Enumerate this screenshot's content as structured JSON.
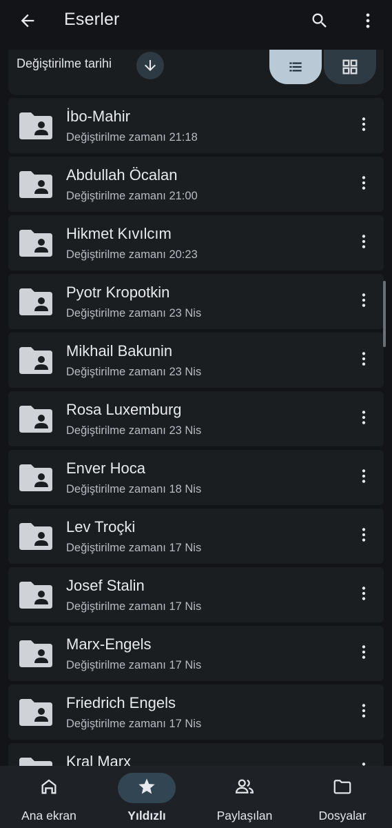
{
  "header": {
    "title": "Eserler",
    "back_icon": "arrow-back-icon",
    "search_icon": "search-icon",
    "more_icon": "more-vert-icon"
  },
  "sort": {
    "label": "Değiştirilme tarihi",
    "direction_icon": "arrow-down-icon"
  },
  "view_toggle": {
    "selected": "list",
    "list_icon": "list-view-icon",
    "grid_icon": "grid-view-icon"
  },
  "folders": [
    {
      "name": "İbo-Mahir",
      "subtitle": "Değiştirilme zamanı 21:18"
    },
    {
      "name": "Abdullah Öcalan",
      "subtitle": "Değiştirilme zamanı 21:00"
    },
    {
      "name": "Hikmet Kıvılcım",
      "subtitle": "Değiştirilme zamanı 20:23"
    },
    {
      "name": "Pyotr Kropotkin",
      "subtitle": "Değiştirilme zamanı 23 Nis"
    },
    {
      "name": "Mikhail Bakunin",
      "subtitle": "Değiştirilme zamanı 23 Nis"
    },
    {
      "name": "Rosa Luxemburg",
      "subtitle": "Değiştirilme zamanı 23 Nis"
    },
    {
      "name": "Enver Hoca",
      "subtitle": "Değiştirilme zamanı 18 Nis"
    },
    {
      "name": "Lev Troçki",
      "subtitle": "Değiştirilme zamanı 17 Nis"
    },
    {
      "name": "Josef Stalin",
      "subtitle": "Değiştirilme zamanı 17 Nis"
    },
    {
      "name": "Marx-Engels",
      "subtitle": "Değiştirilme zamanı 17 Nis"
    },
    {
      "name": "Friedrich Engels",
      "subtitle": "Değiştirilme zamanı 17 Nis"
    },
    {
      "name": "Kral Marx",
      "subtitle": ""
    }
  ],
  "bottom_nav": [
    {
      "label": "Ana ekran",
      "icon": "home-icon",
      "active": false
    },
    {
      "label": "Yıldızlı",
      "icon": "star-icon",
      "active": true
    },
    {
      "label": "Paylaşılan",
      "icon": "people-icon",
      "active": false
    },
    {
      "label": "Dosyalar",
      "icon": "folder-icon",
      "active": false
    }
  ],
  "colors": {
    "background": "#121417",
    "row": "#1b1e21",
    "active_pill": "#324552",
    "list_toggle": "#b9cad6"
  }
}
